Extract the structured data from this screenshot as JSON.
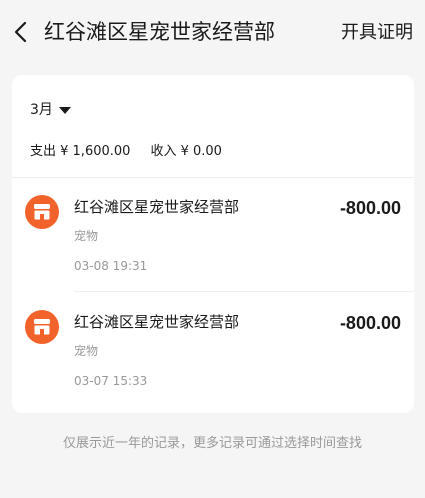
{
  "header": {
    "title": "红谷滩区星宠世家经营部",
    "action_label": "开具证明"
  },
  "filter": {
    "month_label": "3月"
  },
  "summary": {
    "expense": "支出 ¥ 1,600.00",
    "income": "收入 ¥ 0.00"
  },
  "transactions": [
    {
      "merchant": "红谷滩区星宠世家经营部",
      "category": "宠物",
      "time": "03-08 19:31",
      "amount": "-800.00"
    },
    {
      "merchant": "红谷滩区星宠世家经营部",
      "category": "宠物",
      "time": "03-07 15:33",
      "amount": "-800.00"
    }
  ],
  "footer": {
    "note": "仅展示近一年的记录，更多记录可通过选择时间查找"
  },
  "colors": {
    "accent": "#f2632b",
    "background": "#f5f5f5",
    "card": "#ffffff",
    "secondary_text": "#999999"
  },
  "icons": {
    "back": "chevron-left-icon",
    "merchant": "shop-icon",
    "dropdown": "caret-down-icon"
  }
}
